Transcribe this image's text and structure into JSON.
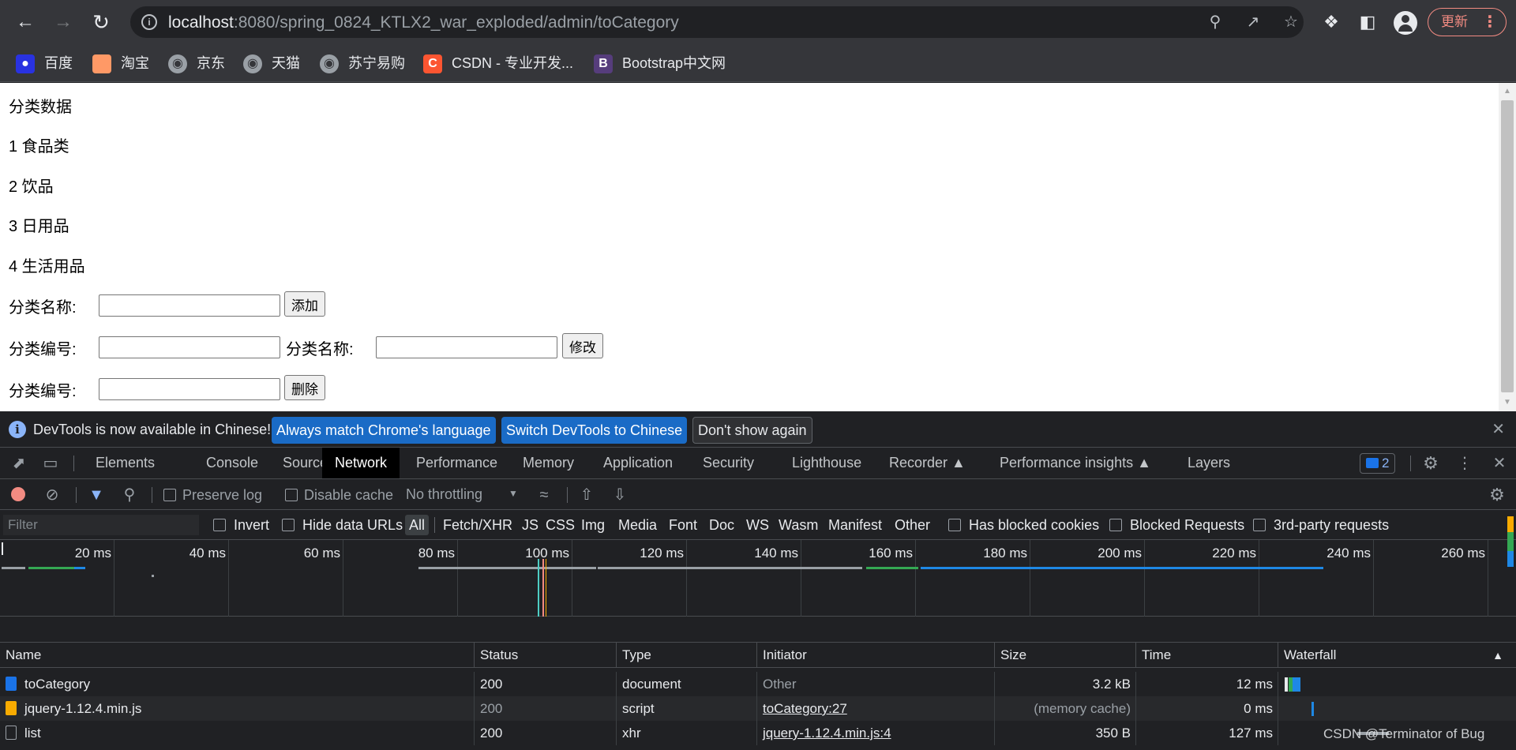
{
  "browser": {
    "url_host": "localhost",
    "url_rest": ":8080/spring_0824_KTLX2_war_exploded/admin/toCategory",
    "update_label": "更新",
    "bookmarks": [
      {
        "label": "百度",
        "icon": "baidu-icon",
        "color": "#2932e1"
      },
      {
        "label": "淘宝",
        "icon": "taobao-icon",
        "color": "#ff5000"
      },
      {
        "label": "京东",
        "icon": "globe-icon",
        "color": "#9aa0a6"
      },
      {
        "label": "天猫",
        "icon": "globe-icon",
        "color": "#9aa0a6"
      },
      {
        "label": "苏宁易购",
        "icon": "globe-icon",
        "color": "#9aa0a6"
      },
      {
        "label": "CSDN - 专业开发...",
        "icon": "csdn-icon",
        "color": "#fc5531"
      },
      {
        "label": "Bootstrap中文网",
        "icon": "bootstrap-icon",
        "color": "#563d7c"
      }
    ]
  },
  "page": {
    "heading": "分类数据",
    "categories": [
      "1 食品类",
      "2 饮品",
      "3 日用品",
      "4 生活用品"
    ],
    "add_form": {
      "name_label": "分类名称:",
      "button": "添加"
    },
    "edit_form": {
      "id_label": "分类编号:",
      "name_label": "分类名称:",
      "button": "修改"
    },
    "delete_form": {
      "id_label": "分类编号:",
      "button": "删除"
    }
  },
  "devtools": {
    "infobar": {
      "message": "DevTools is now available in Chinese!",
      "btn_match": "Always match Chrome's language",
      "btn_switch": "Switch DevTools to Chinese",
      "btn_dismiss": "Don't show again"
    },
    "tabs": [
      "Elements",
      "Console",
      "Sources",
      "Network",
      "Performance",
      "Memory",
      "Application",
      "Security",
      "Lighthouse",
      "Recorder",
      "Performance insights",
      "Layers"
    ],
    "active_tab": "Network",
    "issues_count": "2",
    "network_toolbar": {
      "preserve_log": "Preserve log",
      "disable_cache": "Disable cache",
      "throttling": "No throttling"
    },
    "filter": {
      "placeholder": "Filter",
      "invert": "Invert",
      "hide_data_urls": "Hide data URLs",
      "types": [
        "All",
        "Fetch/XHR",
        "JS",
        "CSS",
        "Img",
        "Media",
        "Font",
        "Doc",
        "WS",
        "Wasm",
        "Manifest",
        "Other"
      ],
      "active_type": "All",
      "has_blocked_cookies": "Has blocked cookies",
      "blocked_requests": "Blocked Requests",
      "third_party": "3rd-party requests"
    },
    "overview_ticks": [
      "20 ms",
      "40 ms",
      "60 ms",
      "80 ms",
      "100 ms",
      "120 ms",
      "140 ms",
      "160 ms",
      "180 ms",
      "200 ms",
      "220 ms",
      "240 ms",
      "260 ms"
    ],
    "columns": [
      "Name",
      "Status",
      "Type",
      "Initiator",
      "Size",
      "Time",
      "Waterfall"
    ],
    "requests": [
      {
        "name": "toCategory",
        "status": "200",
        "type": "document",
        "initiator": "Other",
        "size": "3.2 kB",
        "time": "12 ms",
        "icon": "document-icon"
      },
      {
        "name": "jquery-1.12.4.min.js",
        "status": "200",
        "type": "script",
        "initiator": "toCategory:27",
        "size": "(memory cache)",
        "time": "0 ms",
        "icon": "script-icon"
      },
      {
        "name": "list",
        "status": "200",
        "type": "xhr",
        "initiator": "jquery-1.12.4.min.js:4",
        "size": "350 B",
        "time": "127 ms",
        "icon": "xhr-icon"
      }
    ]
  },
  "watermark": "CSDN @Terminator of Bug"
}
